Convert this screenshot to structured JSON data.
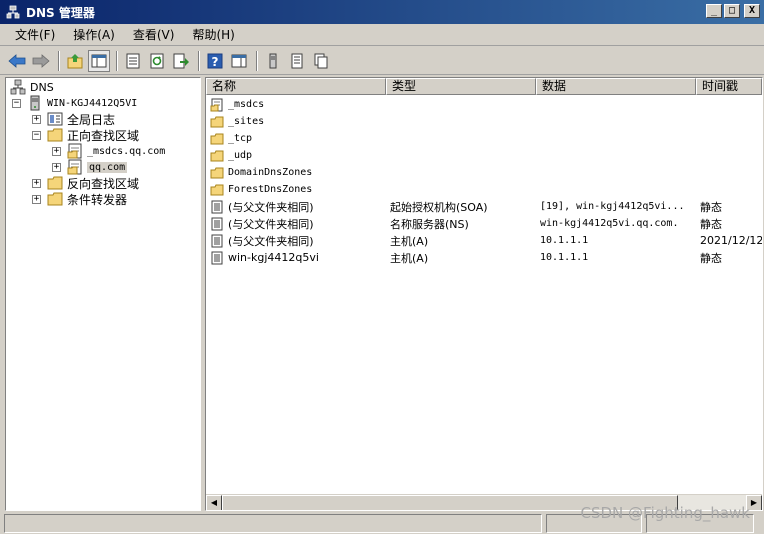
{
  "window": {
    "title": "DNS 管理器"
  },
  "window_controls": {
    "minimize": "_",
    "maximize": "□",
    "close": "X"
  },
  "menu": [
    {
      "label": "文件(F)"
    },
    {
      "label": "操作(A)"
    },
    {
      "label": "查看(V)"
    },
    {
      "label": "帮助(H)"
    }
  ],
  "toolbar": {
    "icons": [
      "back-icon",
      "forward-icon",
      "up-folder-icon",
      "show-hide-tree-icon",
      "properties-icon",
      "refresh-icon",
      "export-list-icon",
      "help-icon",
      "show-hide-action-pane-icon",
      "server-icon",
      "list-icon",
      "copy-icon"
    ]
  },
  "tree": {
    "root": "DNS",
    "server": "WIN-KGJ4412Q5VI",
    "nodes": [
      {
        "label": "全局日志",
        "expander": "+"
      },
      {
        "label": "正向查找区域",
        "expander": "−"
      },
      {
        "label": "_msdcs.qq.com",
        "expander": "+"
      },
      {
        "label": "qq.com",
        "expander": "+"
      },
      {
        "label": "反向查找区域",
        "expander": "+"
      },
      {
        "label": "条件转发器",
        "expander": "+"
      }
    ]
  },
  "list": {
    "columns": [
      "名称",
      "类型",
      "数据",
      "时间戳"
    ],
    "rows": [
      {
        "name": "_msdcs",
        "type": "",
        "data": "",
        "time": "",
        "icon": "zone-folder"
      },
      {
        "name": "_sites",
        "type": "",
        "data": "",
        "time": "",
        "icon": "folder"
      },
      {
        "name": "_tcp",
        "type": "",
        "data": "",
        "time": "",
        "icon": "folder"
      },
      {
        "name": "_udp",
        "type": "",
        "data": "",
        "time": "",
        "icon": "folder"
      },
      {
        "name": "DomainDnsZones",
        "type": "",
        "data": "",
        "time": "",
        "icon": "folder"
      },
      {
        "name": "ForestDnsZones",
        "type": "",
        "data": "",
        "time": "",
        "icon": "folder"
      },
      {
        "name": "(与父文件夹相同)",
        "type": "起始授权机构(SOA)",
        "data": "[19], win-kgj4412q5vi...",
        "time": "静态",
        "icon": "record"
      },
      {
        "name": "(与父文件夹相同)",
        "type": "名称服务器(NS)",
        "data": "win-kgj4412q5vi.qq.com.",
        "time": "静态",
        "icon": "record"
      },
      {
        "name": "(与父文件夹相同)",
        "type": "主机(A)",
        "data": "10.1.1.1",
        "time": "2021/12/12",
        "icon": "record"
      },
      {
        "name": "win-kgj4412q5vi",
        "type": "主机(A)",
        "data": "10.1.1.1",
        "time": "静态",
        "icon": "record"
      }
    ]
  },
  "scrollbar": {
    "left_arrow": "◀",
    "right_arrow": "▶"
  },
  "watermark": "CSDN @Fighting_hawk",
  "colors": {
    "title_start": "#0a246a",
    "title_end": "#3a6ea5",
    "folder": "#f5d57a",
    "chrome": "#d4d0c8"
  }
}
